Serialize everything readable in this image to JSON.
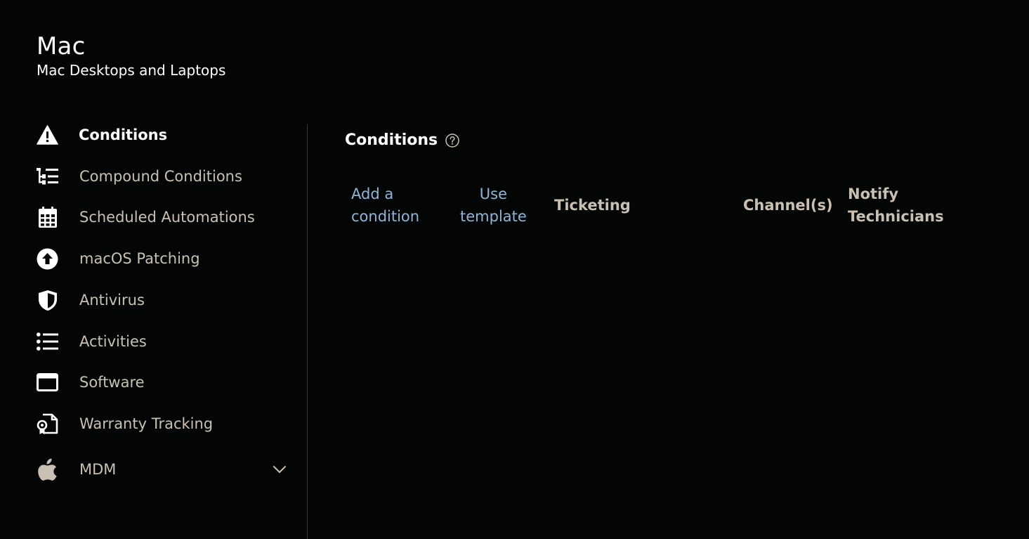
{
  "header": {
    "title": "Mac",
    "subtitle": "Mac Desktops and Laptops"
  },
  "sidebar": {
    "items": [
      {
        "label": "Conditions",
        "icon": "warning-icon",
        "active": true
      },
      {
        "label": "Compound Conditions",
        "icon": "tree-list-icon"
      },
      {
        "label": "Scheduled Automations",
        "icon": "calendar-icon"
      },
      {
        "label": "macOS Patching",
        "icon": "upload-circle-icon"
      },
      {
        "label": "Antivirus",
        "icon": "shield-icon"
      },
      {
        "label": "Activities",
        "icon": "list-icon"
      },
      {
        "label": "Software",
        "icon": "window-icon"
      },
      {
        "label": "Warranty Tracking",
        "icon": "warranty-document-icon"
      },
      {
        "label": "MDM",
        "icon": "apple-icon",
        "expandable": true
      }
    ]
  },
  "main": {
    "title": "Conditions",
    "help_icon": "question-circle-icon",
    "actions": {
      "add_condition_line1": "Add a",
      "add_condition_line2": "condition",
      "use_template_line1": "Use",
      "use_template_line2": "template"
    },
    "columns": {
      "ticketing": "Ticketing",
      "channels": "Channel(s)",
      "notify_line1": "Notify",
      "notify_line2": "Technicians"
    }
  },
  "colors": {
    "background": "#040606",
    "text_muted": "#c9c0b3",
    "link": "#8fb5d6",
    "active": "#ffffff"
  }
}
